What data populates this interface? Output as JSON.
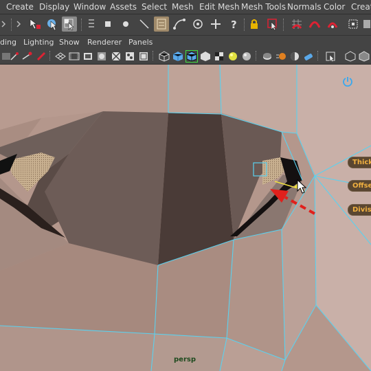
{
  "menu": {
    "items": [
      "Create",
      "Display",
      "Window",
      "Assets",
      "Select",
      "Mesh",
      "Edit Mesh",
      "Mesh Tools",
      "Normals",
      "Color",
      "Create"
    ]
  },
  "panel_menu": {
    "items": [
      "ding",
      "Lighting",
      "Show",
      "Renderer",
      "Panels"
    ]
  },
  "viewport": {
    "camera_label": "persp",
    "hud": {
      "thickness_label": "Thick",
      "offset_label": "Offse",
      "divisions_label": "Divis"
    }
  },
  "colors": {
    "ui_background": "#444444",
    "menu_text": "#dcdcdc",
    "wireframe": "#5ad2f0",
    "hud_text": "#f0b040",
    "annotation_arrow": "#e0201c"
  }
}
